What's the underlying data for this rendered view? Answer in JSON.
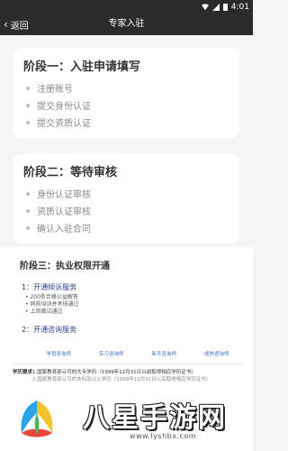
{
  "status_bar": {
    "time": "4:01"
  },
  "app_bar": {
    "back_label": "返回",
    "title": "专家入驻"
  },
  "stage1": {
    "title": "阶段一：入驻申请填写",
    "items": [
      "注册账号",
      "提交身份认证",
      "提交资质认证"
    ]
  },
  "stage2": {
    "title": "阶段二：等待审核",
    "items": [
      "身份认证审核",
      "资质认证审核",
      "确认入驻合同"
    ]
  },
  "doc": {
    "title": "阶段三：执业权限开通",
    "section1": {
      "heading": "1：开通倾诉服务",
      "items": [
        "• 200条合格公益解答",
        "• 同前培训并考核通过",
        "• 上岗面试通过"
      ]
    },
    "section2": {
      "heading": "2：开通咨询服务"
    },
    "table": {
      "headers": [
        "",
        "学员咨询师",
        "实习咨询师",
        "新手咨询师",
        "成熟咨询师"
      ],
      "row_head": "学历要求",
      "row_text_1": "1.国家教育部认可的大专学历（1999年12月31日以前取得相应学历证书）",
      "row_text_2": "2.国家教育部认可的本科及以上学历（1999年12月31日以后取得相应学历证书）"
    }
  },
  "watermark": {
    "text": "八星手游网",
    "url": "www.lyshbx.com"
  }
}
